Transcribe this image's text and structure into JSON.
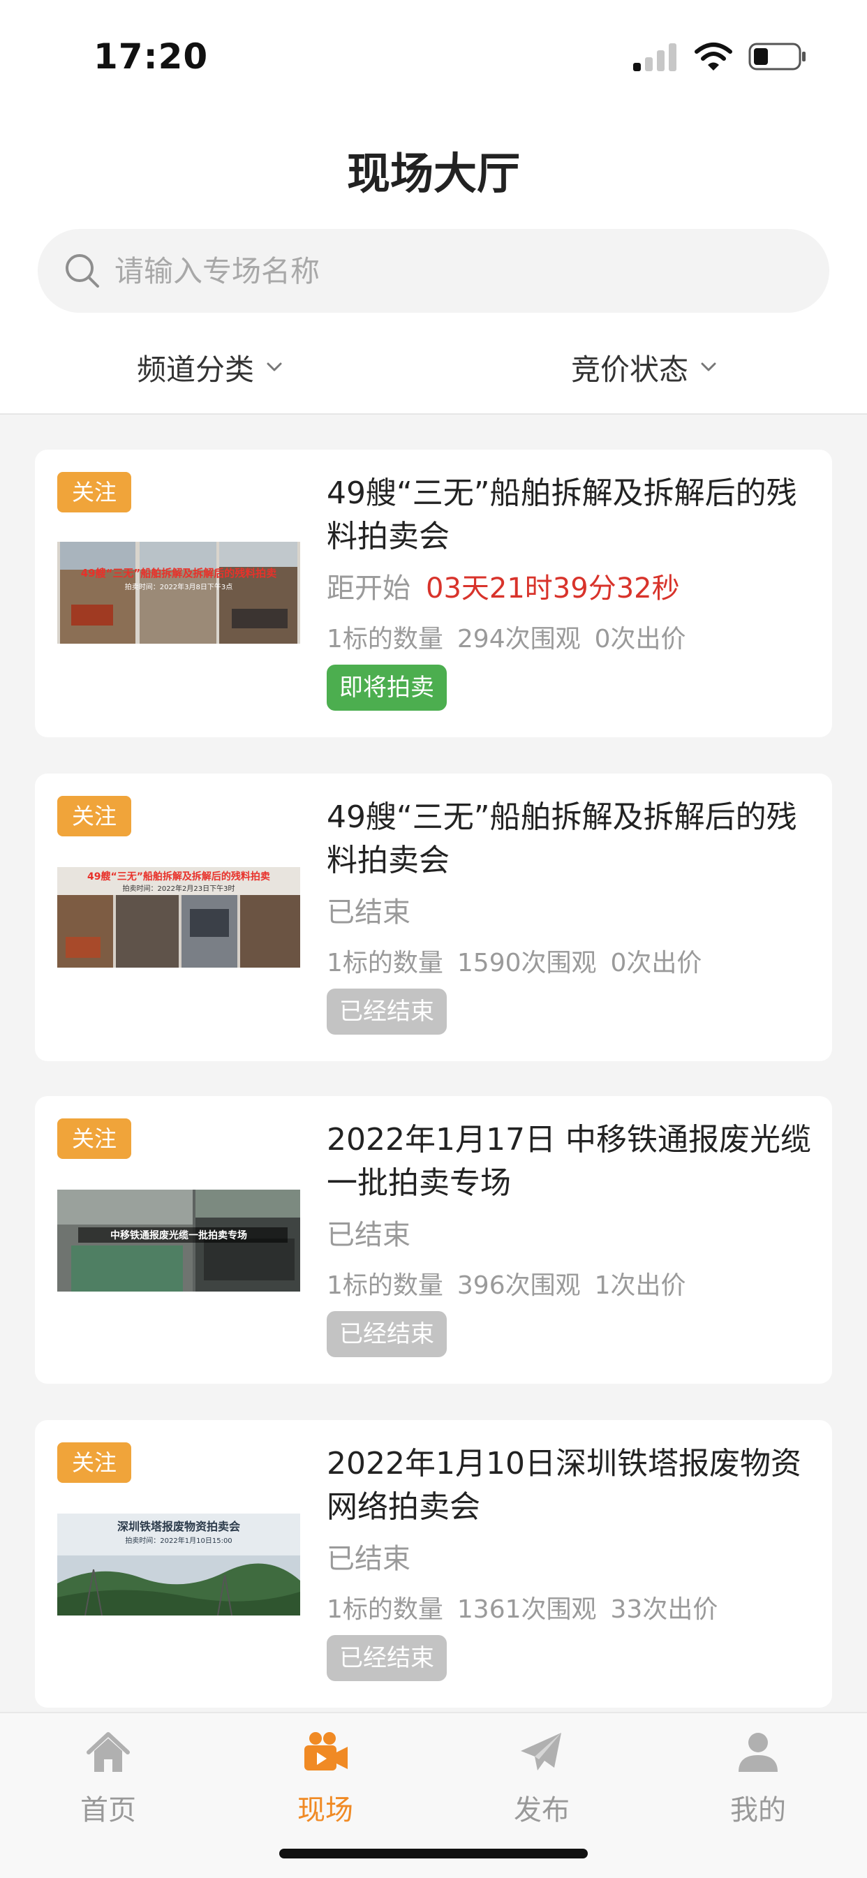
{
  "status_bar": {
    "time": "17:20"
  },
  "header": {
    "title": "现场大厅"
  },
  "search": {
    "placeholder": "请输入专场名称"
  },
  "filters": [
    {
      "label": "频道分类"
    },
    {
      "label": "竞价状态"
    }
  ],
  "cards": [
    {
      "follow": "关注",
      "title": "49艘“三无”船舶拆解及拆解后的残料拍卖会",
      "status_label": "距开始",
      "countdown": "03天21时39分32秒",
      "stats": [
        "1标的数量",
        "294次围观",
        "0次出价"
      ],
      "badge": "即将拍卖",
      "thumb_banner": "49艘“三无”船舶拆解及拆解后的残料拍卖",
      "thumb_sub": "拍卖时间：2022年3月8日下午3点"
    },
    {
      "follow": "关注",
      "title": "49艘“三无”船舶拆解及拆解后的残料拍卖会",
      "status_label": "已结束",
      "stats": [
        "1标的数量",
        "1590次围观",
        "0次出价"
      ],
      "badge": "已经结束",
      "thumb_banner": "49艘“三无”船舶拆解及拆解后的残料拍卖",
      "thumb_sub": "拍卖时间：2022年2月23日下午3时"
    },
    {
      "follow": "关注",
      "title": "2022年1月17日 中移铁通报废光缆一批拍卖专场",
      "status_label": "已结束",
      "stats": [
        "1标的数量",
        "396次围观",
        "1次出价"
      ],
      "badge": "已经结束",
      "thumb_banner": "中移铁通报废光缆一批拍卖专场"
    },
    {
      "follow": "关注",
      "title": "2022年1月10日深圳铁塔报废物资网络拍卖会",
      "status_label": "已结束",
      "stats": [
        "1标的数量",
        "1361次围观",
        "33次出价"
      ],
      "badge": "已经结束",
      "thumb_banner": "深圳铁塔报废物资拍卖会",
      "thumb_sub": "拍卖时间：2022年1月10日15:00"
    }
  ],
  "tabbar": {
    "items": [
      {
        "label": "首页",
        "icon": "home-icon"
      },
      {
        "label": "现场",
        "icon": "video-camera-icon",
        "active": true
      },
      {
        "label": "发布",
        "icon": "paper-plane-icon"
      },
      {
        "label": "我的",
        "icon": "person-icon"
      }
    ]
  },
  "colors": {
    "accent": "#f08a24",
    "follow_badge": "#f0a43a",
    "countdown": "#d8332b",
    "upcoming_badge": "#4cae4f",
    "ended_badge": "#c3c3c3"
  }
}
